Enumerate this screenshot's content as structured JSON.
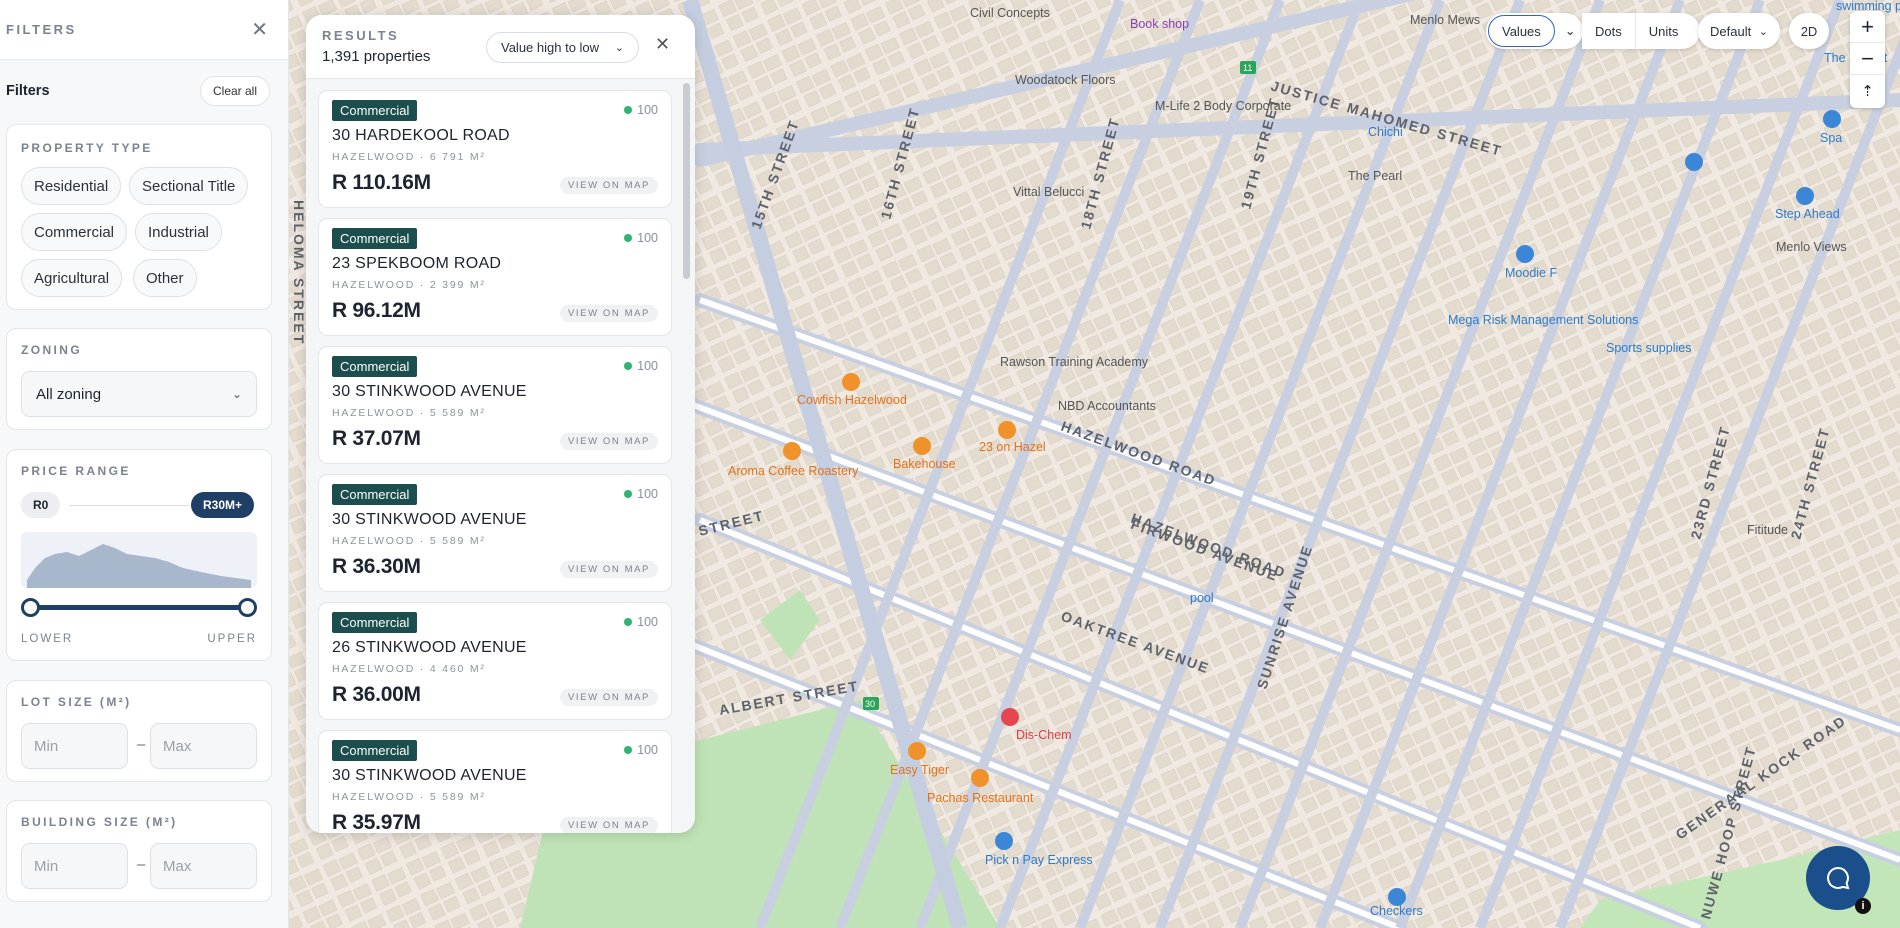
{
  "filters": {
    "header_title": "FILTERS",
    "section_label": "Filters",
    "clear_all": "Clear all",
    "property_type": {
      "title": "PROPERTY TYPE",
      "options": [
        "Residential",
        "Sectional Title",
        "Commercial",
        "Industrial",
        "Agricultural",
        "Other"
      ]
    },
    "zoning": {
      "title": "ZONING",
      "value": "All zoning"
    },
    "price_range": {
      "title": "PRICE RANGE",
      "min_label": "R0",
      "max_label": "R30M+",
      "lower": "LOWER",
      "upper": "UPPER"
    },
    "lot_size": {
      "title": "LOT SIZE (M²)",
      "min_placeholder": "Min",
      "max_placeholder": "Max"
    },
    "building_size": {
      "title": "BUILDING SIZE (M²)",
      "min_placeholder": "Min",
      "max_placeholder": "Max"
    }
  },
  "results": {
    "title": "RESULTS",
    "count": "1,391 properties",
    "sort_value": "Value high to low",
    "view_on_map": "VIEW ON MAP",
    "items": [
      {
        "type": "Commercial",
        "score": "100",
        "address": "30 HARDEKOOL ROAD",
        "meta": "HAZELWOOD · 6 791 M²",
        "price": "R 110.16M"
      },
      {
        "type": "Commercial",
        "score": "100",
        "address": "23 SPEKBOOM ROAD",
        "meta": "HAZELWOOD · 2 399 M²",
        "price": "R 96.12M"
      },
      {
        "type": "Commercial",
        "score": "100",
        "address": "30 STINKWOOD AVENUE",
        "meta": "HAZELWOOD · 5 589 M²",
        "price": "R 37.07M"
      },
      {
        "type": "Commercial",
        "score": "100",
        "address": "30 STINKWOOD AVENUE",
        "meta": "HAZELWOOD · 5 589 M²",
        "price": "R 36.30M"
      },
      {
        "type": "Commercial",
        "score": "100",
        "address": "26 STINKWOOD AVENUE",
        "meta": "HAZELWOOD · 4 460 M²",
        "price": "R 36.00M"
      },
      {
        "type": "Commercial",
        "score": "100",
        "address": "30 STINKWOOD AVENUE",
        "meta": "HAZELWOOD · 5 589 M²",
        "price": "R 35.97M"
      }
    ]
  },
  "map_controls": {
    "modes": [
      "Values",
      "Dots",
      "Units"
    ],
    "style": "Default",
    "view": "2D",
    "zoom_in": "+",
    "zoom_out": "−"
  },
  "map": {
    "roads": [
      "JUSTICE MAHOMED STREET",
      "HAZELWOOD ROAD",
      "FIRWOOD AVENUE",
      "OAKTREE AVENUE",
      "ALBERT STREET",
      "15TH STREET",
      "16TH STREET",
      "18TH STREET",
      "19TH STREET",
      "SUNRISE AVENUE",
      "23RD STREET",
      "24TH STREET",
      "GENERAAL KOCK ROAD",
      "NUWE HOOP STREET",
      "HELOMA STREET",
      "STREET"
    ],
    "pois": [
      "Civil Concepts",
      "Book shop",
      "Menlo Mews",
      "Woodatock Floors",
      "M-Life 2 Body Corporate",
      "Chichi",
      "The Pearl",
      "Spa",
      "Vittal Belucci",
      "Moodie F",
      "Step Ahead",
      "Menlo Views",
      "Mega Risk Management Solutions",
      "Sports supplies",
      "Rawson Training Academy",
      "NBD Accountants",
      "Cowfish Hazelwood",
      "Aroma Coffee Roastery",
      "Bakehouse",
      "23 on Hazel",
      "Fititude",
      "pool",
      "Dis-Chem",
      "Easy Tiger",
      "Pachas Restaurant",
      "Pick n Pay Express",
      "Checkers",
      "swimming pool",
      "The Baptist",
      "Hazelwood",
      "11",
      "30"
    ]
  }
}
